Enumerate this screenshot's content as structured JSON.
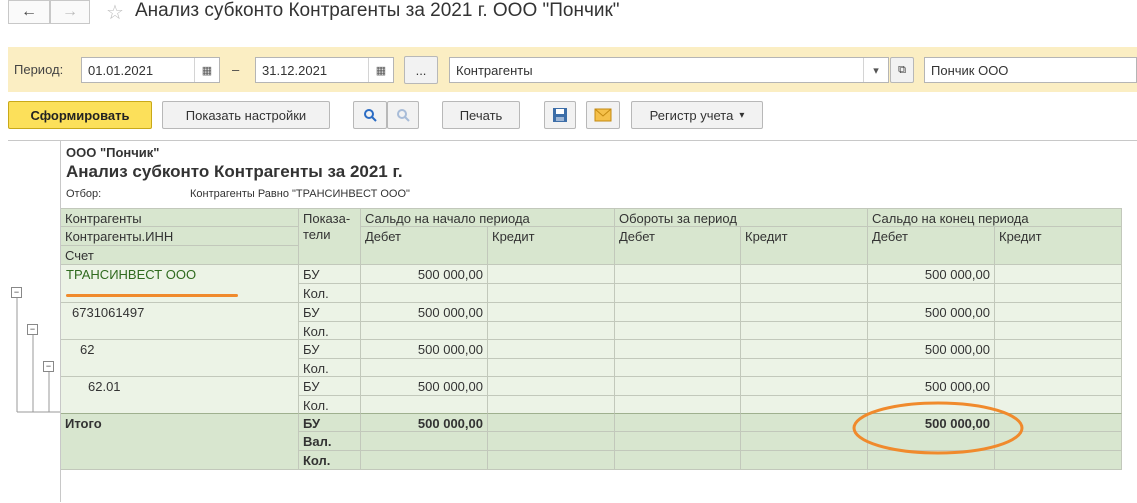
{
  "window": {
    "title": "Анализ субконто Контрагенты за 2021 г. ООО \"Пончик\""
  },
  "nav": {
    "back_icon": "arrow-left-icon",
    "forward_icon": "arrow-right-icon",
    "favorite_icon": "star-icon"
  },
  "params": {
    "period_label": "Период:",
    "date_from": "01.01.2021",
    "dash": "–",
    "date_to": "31.12.2021",
    "ellipsis": "...",
    "subconto": "Контрагенты",
    "org": "Пончик ООО"
  },
  "toolbar": {
    "generate": "Сформировать",
    "show_settings": "Показать настройки",
    "print": "Печать",
    "register": "Регистр учета"
  },
  "report": {
    "org": "ООО \"Пончик\"",
    "title": "Анализ субконто Контрагенты за 2021 г.",
    "filter_label": "Отбор:",
    "filter_value": "Контрагенты Равно \"ТРАНСИНВЕСТ ООО\"",
    "headers": {
      "kontr": "Контрагенты",
      "inn": "Контрагенты.ИНН",
      "schet": "Счет",
      "pokaz": "Показа-\nтели",
      "saldo_start": "Сальдо на начало периода",
      "oboroty": "Обороты за период",
      "saldo_end": "Сальдо на конец периода",
      "debet": "Дебет",
      "kredit": "Кредит"
    },
    "rows": [
      {
        "name": "ТРАНСИНВЕСТ ООО",
        "bu": "БУ",
        "kol": "Кол.",
        "start_debet": "500 000,00",
        "end_debet": "500 000,00"
      },
      {
        "name": "6731061497",
        "bu": "БУ",
        "kol": "Кол.",
        "start_debet": "500 000,00",
        "end_debet": "500 000,00"
      },
      {
        "name": "62",
        "bu": "БУ",
        "kol": "Кол.",
        "start_debet": "500 000,00",
        "end_debet": "500 000,00"
      },
      {
        "name": "62.01",
        "bu": "БУ",
        "kol": "Кол.",
        "start_debet": "500 000,00",
        "end_debet": "500 000,00"
      }
    ],
    "total": {
      "name": "Итого",
      "bu": "БУ",
      "val": "Вал.",
      "kol": "Кол.",
      "start_debet": "500 000,00",
      "end_debet": "500 000,00"
    }
  },
  "colors": {
    "accent": "#fce05a",
    "header_bg": "#d8e6cf",
    "row_bg": "#ecf3e6",
    "highlight": "#f08a2c"
  }
}
